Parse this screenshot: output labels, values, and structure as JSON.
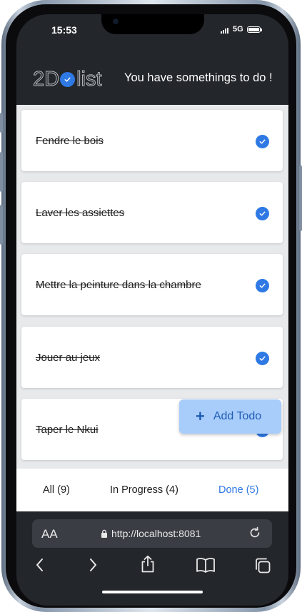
{
  "status": {
    "time": "15:53",
    "network": "5G"
  },
  "header": {
    "logo_left": "2D",
    "logo_right": "list",
    "tagline": "You have somethings to do !"
  },
  "todos": [
    {
      "label": "Fendre le bois",
      "done": true
    },
    {
      "label": "Laver les assiettes",
      "done": true
    },
    {
      "label": "Mettre la peinture dans la chambre",
      "done": true
    },
    {
      "label": "Jouer au jeux",
      "done": true
    },
    {
      "label": "Taper le Nkui",
      "done": true
    }
  ],
  "fab": {
    "icon": "plus-icon",
    "label": "Add Todo"
  },
  "tabs": [
    {
      "label": "All (9)",
      "active": false
    },
    {
      "label": "In Progress (4)",
      "active": false
    },
    {
      "label": "Done (5)",
      "active": true
    }
  ],
  "browser": {
    "text_size": "AA",
    "url": "http://localhost:8081"
  },
  "colors": {
    "accent": "#2e79e4",
    "fab_bg": "#a9cdfb",
    "header_bg": "#23262b"
  }
}
